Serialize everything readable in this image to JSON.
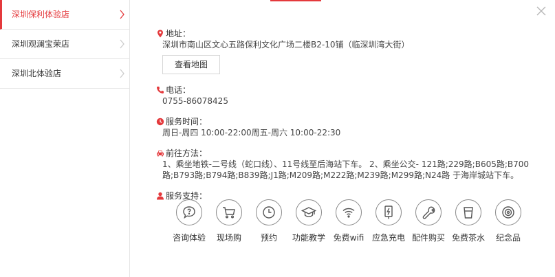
{
  "stores": [
    {
      "name": "深圳保利体验店",
      "active": true
    },
    {
      "name": "深圳观澜宝荣店",
      "active": false
    },
    {
      "name": "深圳北体验店",
      "active": false
    }
  ],
  "address": {
    "label": "地址：",
    "value": "深圳市南山区文心五路保利文化广场二楼B2-10铺（临深圳湾大街）",
    "map_button": "查看地图"
  },
  "phone": {
    "label": "电话：",
    "value": "0755-86078425"
  },
  "hours": {
    "label": "服务时间：",
    "value": "周日-周四 10:00-22:00周五-周六 10:00-22:30"
  },
  "directions": {
    "label": "前往方法：",
    "line1": "1、乘坐地铁-二号线（蛇口线）、11号线至后海站下车。 2、乘坐公交- 121路;229路;B605路;B700",
    "line2": "路;B793路;B794路;B839路;J1路;M209路;M222路;M239路;M299路;N24路 于海岸城站下车。"
  },
  "services": {
    "label": "服务支持：",
    "items": [
      {
        "name": "咨询体验",
        "icon": "consult-icon"
      },
      {
        "name": "现场购",
        "icon": "cart-icon"
      },
      {
        "name": "预约",
        "icon": "clock-icon"
      },
      {
        "name": "功能教学",
        "icon": "graduation-cap-icon"
      },
      {
        "name": "免费wifi",
        "icon": "wifi-icon"
      },
      {
        "name": "应急充电",
        "icon": "charging-icon"
      },
      {
        "name": "配件购买",
        "icon": "wrench-icon"
      },
      {
        "name": "免费茶水",
        "icon": "cup-icon"
      },
      {
        "name": "纪念品",
        "icon": "souvenir-icon"
      }
    ]
  },
  "colors": {
    "accent": "#e4393c",
    "border": "#e5e5e5",
    "icon_stroke": "#8a8a8a"
  }
}
